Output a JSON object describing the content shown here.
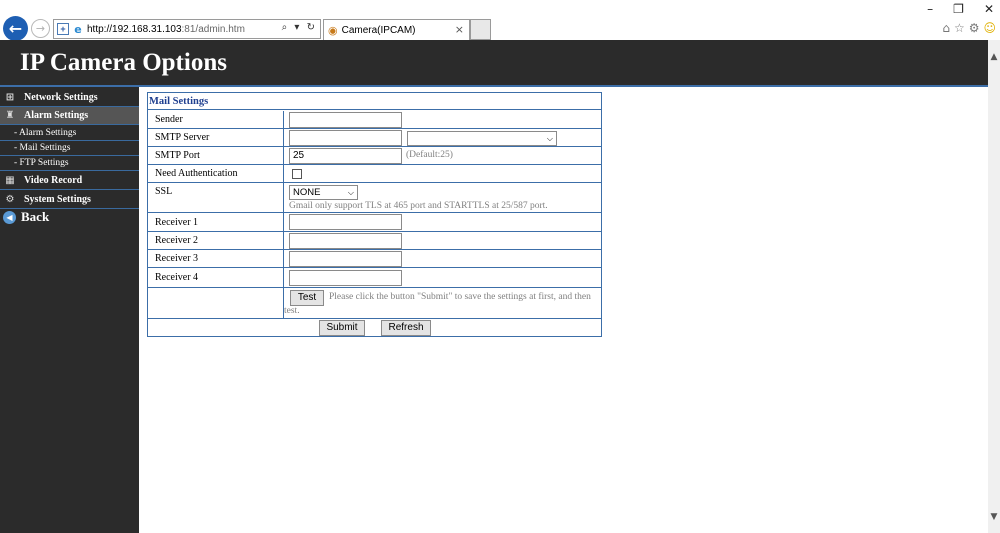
{
  "browser": {
    "url_host": "http://192.168.31.103",
    "url_rest": ":81/admin.htm",
    "url_tools": "⌕ ▾ ↻",
    "tab_title": "Camera(IPCAM)",
    "tab_close": "×",
    "window_controls": [
      "–",
      "❐",
      "✕"
    ],
    "toolbar_icons": [
      "⌂",
      "☆",
      "⚙",
      "☺"
    ]
  },
  "header": {
    "title": "IP Camera Options"
  },
  "sidebar": {
    "items": [
      {
        "label": "Network Settings",
        "icon": "network-icon"
      },
      {
        "label": "Alarm Settings",
        "icon": "alarm-icon"
      },
      {
        "label": "Video Record",
        "icon": "film-icon"
      },
      {
        "label": "System Settings",
        "icon": "gear-icon"
      }
    ],
    "sub_items": [
      "- Alarm Settings",
      "- Mail Settings",
      "- FTP Settings"
    ],
    "back_label": "Back"
  },
  "mail": {
    "section_title": "Mail Settings",
    "sender_label": "Sender",
    "sender_value": "",
    "smtp_server_label": "SMTP Server",
    "smtp_server_value": "",
    "smtp_server_preset": "",
    "smtp_port_label": "SMTP Port",
    "smtp_port_value": "25",
    "smtp_port_hint": "(Default:25)",
    "need_auth_label": "Need Authentication",
    "need_auth_checked": false,
    "ssl_label": "SSL",
    "ssl_value": "NONE",
    "ssl_note": "Gmail only support TLS at 465 port and STARTTLS at 25/587 port.",
    "receiver1_label": "Receiver 1",
    "receiver2_label": "Receiver 2",
    "receiver3_label": "Receiver 3",
    "receiver4_label": "Receiver 4",
    "receiver1_value": "",
    "receiver2_value": "",
    "receiver3_value": "",
    "receiver4_value": "",
    "test_button": "Test",
    "test_note": "Please click the button \"Submit\" to save the settings at first, and then test.",
    "submit_button": "Submit",
    "refresh_button": "Refresh"
  },
  "colors": {
    "header_bg": "#2b2b2b",
    "accent_border": "#3c6ea8",
    "section_title": "#1f3f8f"
  }
}
